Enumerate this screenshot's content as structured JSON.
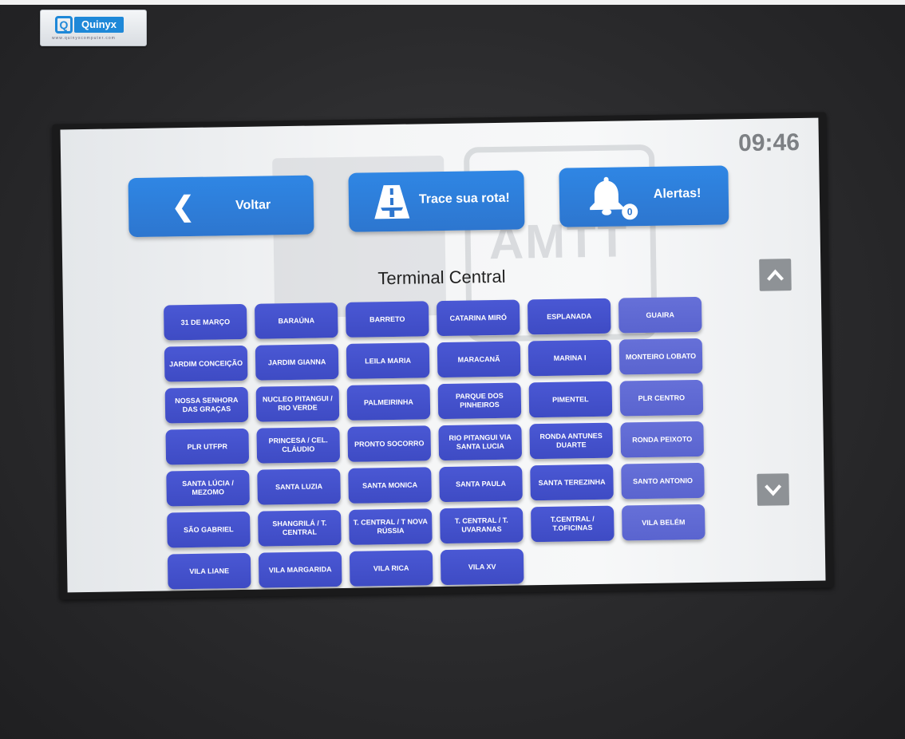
{
  "logo": {
    "name": "Quinyx",
    "url": "www.quinyxcomputer.com"
  },
  "clock": "09:46",
  "buttons": {
    "back": "Voltar",
    "route": "Trace sua rota!",
    "alerts": "Alertas!",
    "alert_count": "0"
  },
  "watermark": "AMTT",
  "title": "Terminal Central",
  "routes": [
    "31 DE MARÇO",
    "BARAÚNA",
    "BARRETO",
    "CATARINA MIRÓ",
    "ESPLANADA",
    "GUAIRA",
    "JARDIM CONCEIÇÃO",
    "JARDIM GIANNA",
    "LEILA MARIA",
    "MARACANÃ",
    "MARINA I",
    "MONTEIRO LOBATO",
    "NOSSA SENHORA DAS GRAÇAS",
    "NUCLEO PITANGUI / RIO VERDE",
    "PALMEIRINHA",
    "PARQUE DOS PINHEIROS",
    "PIMENTEL",
    "PLR CENTRO",
    "PLR UTFPR",
    "PRINCESA / CEL. CLÁUDIO",
    "PRONTO SOCORRO",
    "RIO PITANGUI VIA SANTA LUCIA",
    "RONDA ANTUNES DUARTE",
    "RONDA PEIXOTO",
    "SANTA LÚCIA / MEZOMO",
    "SANTA LUZIA",
    "SANTA MONICA",
    "SANTA PAULA",
    "SANTA TEREZINHA",
    "SANTO ANTONIO",
    "SÃO GABRIEL",
    "SHANGRILÁ / T. CENTRAL",
    "T. CENTRAL / T NOVA RÚSSIA",
    "T. CENTRAL / T. UVARANAS",
    "T.CENTRAL / T.OFICINAS",
    "VILA BELÉM",
    "VILA LIANE",
    "VILA MARGARIDA",
    "VILA RICA",
    "VILA XV"
  ]
}
